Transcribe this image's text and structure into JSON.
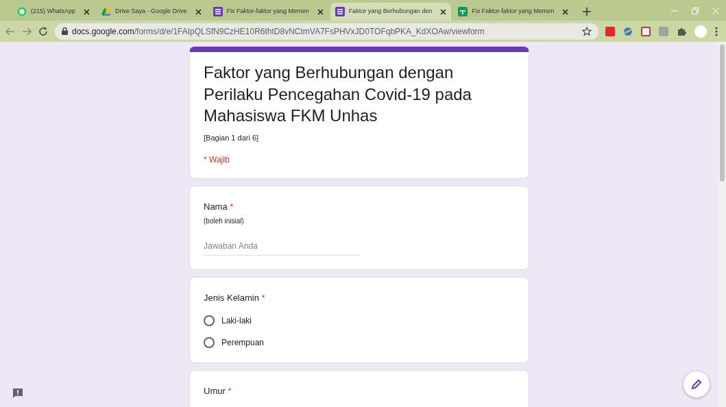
{
  "browser": {
    "tabs": [
      {
        "title": "(215) WhatsApp",
        "selected": false
      },
      {
        "title": "Drive Saya - Google Drive",
        "selected": false
      },
      {
        "title": "Fix Faktor-faktor yang Memen",
        "selected": false
      },
      {
        "title": "Faktor yang Berhubungan den",
        "selected": true
      },
      {
        "title": "Fix Faktor-faktor yang Memen",
        "selected": false
      }
    ],
    "url_host": "docs.google.com",
    "url_path": "/forms/d/e/1FAIpQLSfN9CzHE10R6thtD8vNCtmVA7FsPHVxJD0TOFqbPKA_KdXOAw/viewform"
  },
  "form": {
    "title": "Faktor yang Berhubungan dengan Perilaku Pencegahan Covid-19 pada Mahasiswa FKM Unhas",
    "section": "[Bagian 1 dari 6]",
    "required_note": "* Wajib",
    "questions": [
      {
        "kind": "text",
        "label": "Nama",
        "required_mark": "*",
        "description": "(boleh inisial)",
        "placeholder": "Jawaban Anda"
      },
      {
        "kind": "radio",
        "label": "Jenis Kelamin",
        "required_mark": "*",
        "options": [
          {
            "label": "Laki-laki",
            "selected": false
          },
          {
            "label": "Perempuan",
            "selected": false
          }
        ]
      },
      {
        "kind": "text_cut",
        "label": "Umur",
        "required_mark": "*"
      }
    ]
  }
}
